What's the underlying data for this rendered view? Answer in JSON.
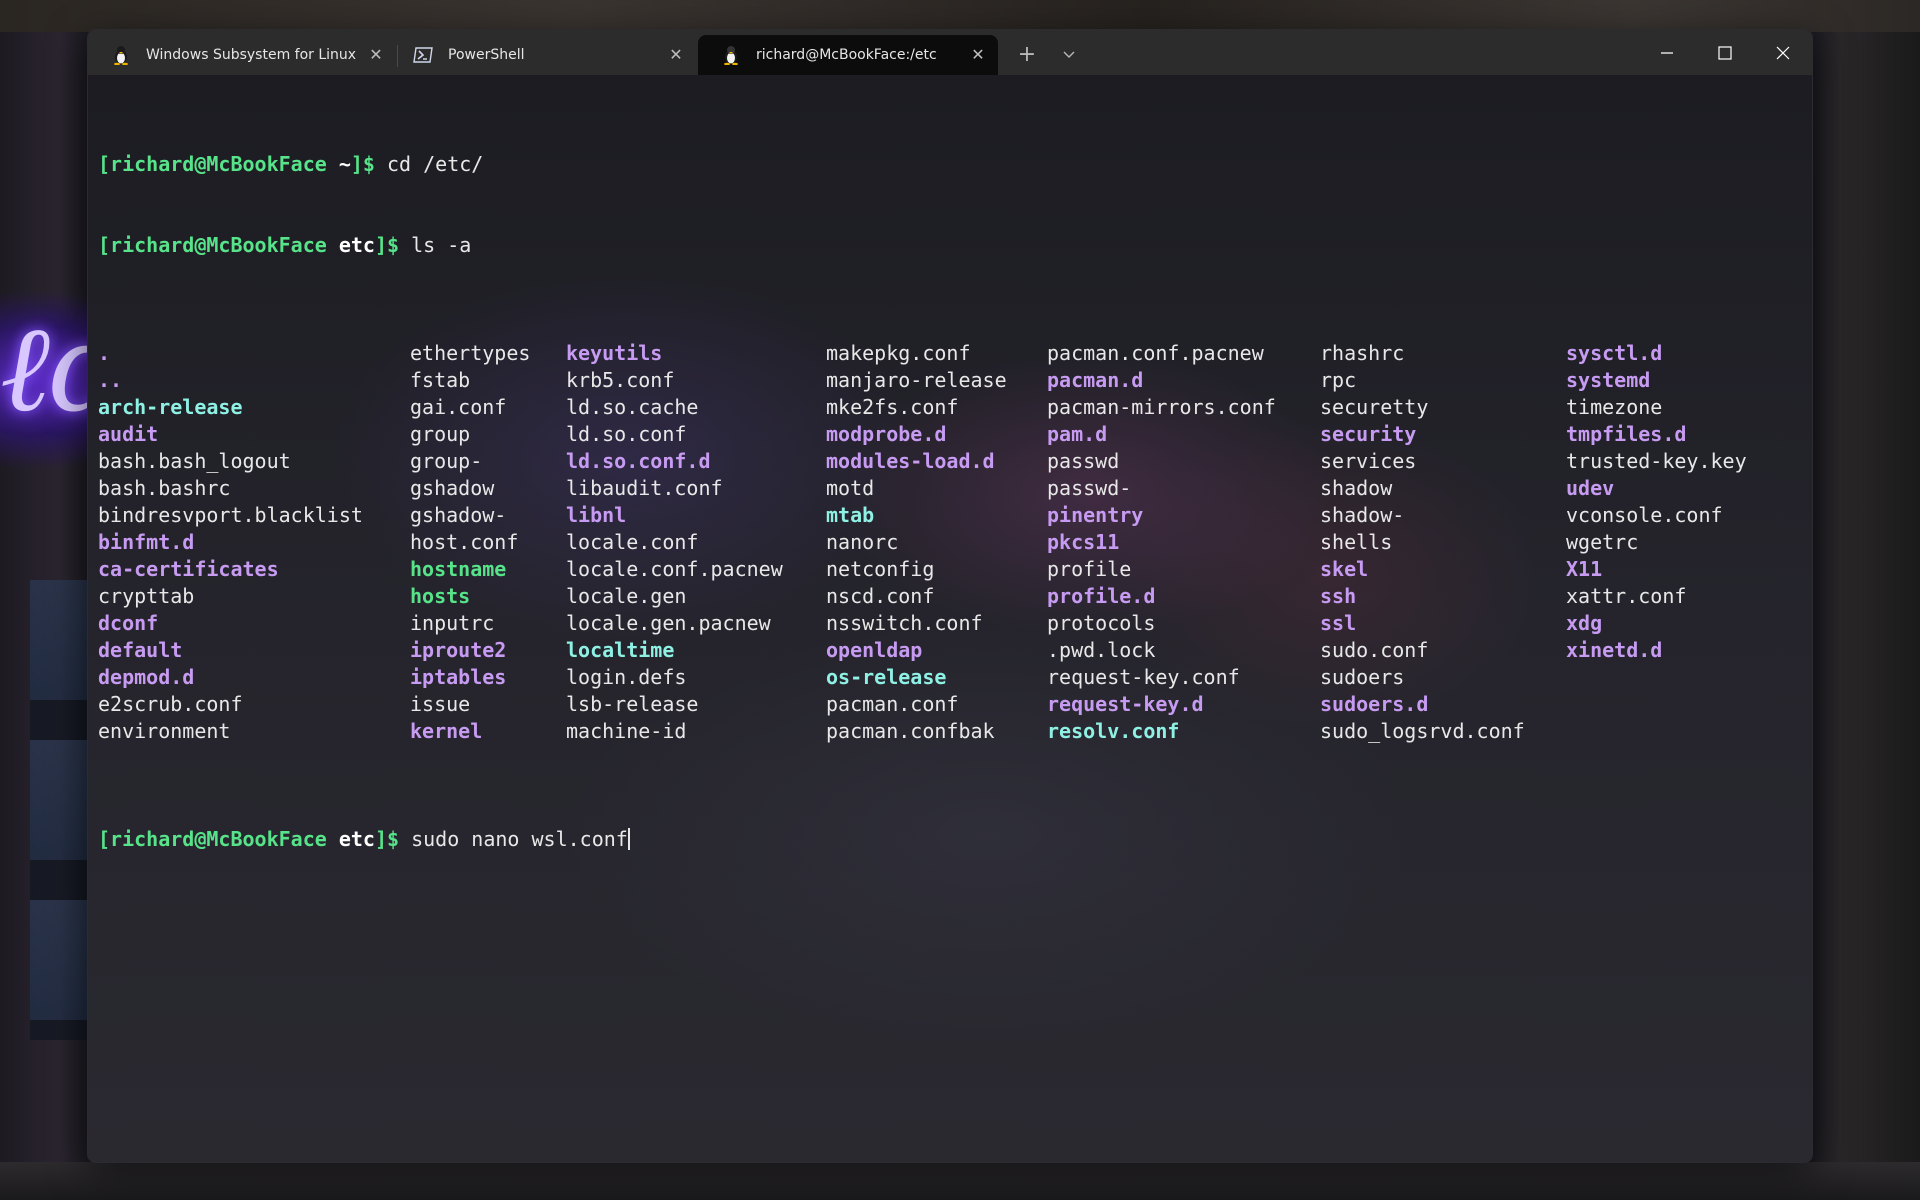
{
  "window": {
    "tabs": [
      {
        "label": "Windows Subsystem for Linux P",
        "icon": "linux-tux-icon",
        "active": false
      },
      {
        "label": "PowerShell",
        "icon": "powershell-icon",
        "active": false
      },
      {
        "label": "richard@McBookFace:/etc",
        "icon": "linux-tux-icon",
        "active": true
      }
    ],
    "new_tab_glyph": "+",
    "dropdown_glyph": "⌄",
    "close_glyph": "✕",
    "controls": {
      "minimize": "—",
      "maximize": "☐",
      "close": "✕"
    }
  },
  "colors": {
    "prompt": "#57e389",
    "directory": "#c79bf2",
    "symlink": "#8ff0e4",
    "executable": "#57e389",
    "file": "#e8e8e8",
    "terminal_bg": "#1e1e24",
    "titlebar_bg": "#2c2c2c"
  },
  "terminal": {
    "lines": [
      {
        "user": "[richard@McBookFace ",
        "dir": "~",
        "suffix": "]$ ",
        "command": "cd /etc/"
      },
      {
        "user": "[richard@McBookFace ",
        "dir": "etc",
        "suffix": "]$ ",
        "command": "ls -a"
      }
    ],
    "ls_columns": [
      [
        {
          "name": ".",
          "type": "dir"
        },
        {
          "name": "..",
          "type": "dir"
        },
        {
          "name": "arch-release",
          "type": "link"
        },
        {
          "name": "audit",
          "type": "dir"
        },
        {
          "name": "bash.bash_logout",
          "type": "file"
        },
        {
          "name": "bash.bashrc",
          "type": "file"
        },
        {
          "name": "bindresvport.blacklist",
          "type": "file"
        },
        {
          "name": "binfmt.d",
          "type": "dir"
        },
        {
          "name": "ca-certificates",
          "type": "dir"
        },
        {
          "name": "crypttab",
          "type": "file"
        },
        {
          "name": "dconf",
          "type": "dir"
        },
        {
          "name": "default",
          "type": "dir"
        },
        {
          "name": "depmod.d",
          "type": "dir"
        },
        {
          "name": "e2scrub.conf",
          "type": "file"
        },
        {
          "name": "environment",
          "type": "file"
        }
      ],
      [
        {
          "name": "ethertypes",
          "type": "file"
        },
        {
          "name": "fstab",
          "type": "file"
        },
        {
          "name": "gai.conf",
          "type": "file"
        },
        {
          "name": "group",
          "type": "file"
        },
        {
          "name": "group-",
          "type": "file"
        },
        {
          "name": "gshadow",
          "type": "file"
        },
        {
          "name": "gshadow-",
          "type": "file"
        },
        {
          "name": "host.conf",
          "type": "file"
        },
        {
          "name": "hostname",
          "type": "exec"
        },
        {
          "name": "hosts",
          "type": "exec"
        },
        {
          "name": "inputrc",
          "type": "file"
        },
        {
          "name": "iproute2",
          "type": "dir"
        },
        {
          "name": "iptables",
          "type": "dir"
        },
        {
          "name": "issue",
          "type": "file"
        },
        {
          "name": "kernel",
          "type": "dir"
        }
      ],
      [
        {
          "name": "keyutils",
          "type": "dir"
        },
        {
          "name": "krb5.conf",
          "type": "file"
        },
        {
          "name": "ld.so.cache",
          "type": "file"
        },
        {
          "name": "ld.so.conf",
          "type": "file"
        },
        {
          "name": "ld.so.conf.d",
          "type": "dir"
        },
        {
          "name": "libaudit.conf",
          "type": "file"
        },
        {
          "name": "libnl",
          "type": "dir"
        },
        {
          "name": "locale.conf",
          "type": "file"
        },
        {
          "name": "locale.conf.pacnew",
          "type": "file"
        },
        {
          "name": "locale.gen",
          "type": "file"
        },
        {
          "name": "locale.gen.pacnew",
          "type": "file"
        },
        {
          "name": "localtime",
          "type": "link"
        },
        {
          "name": "login.defs",
          "type": "file"
        },
        {
          "name": "lsb-release",
          "type": "file"
        },
        {
          "name": "machine-id",
          "type": "file"
        }
      ],
      [
        {
          "name": "makepkg.conf",
          "type": "file"
        },
        {
          "name": "manjaro-release",
          "type": "file"
        },
        {
          "name": "mke2fs.conf",
          "type": "file"
        },
        {
          "name": "modprobe.d",
          "type": "dir"
        },
        {
          "name": "modules-load.d",
          "type": "dir"
        },
        {
          "name": "motd",
          "type": "file"
        },
        {
          "name": "mtab",
          "type": "link"
        },
        {
          "name": "nanorc",
          "type": "file"
        },
        {
          "name": "netconfig",
          "type": "file"
        },
        {
          "name": "nscd.conf",
          "type": "file"
        },
        {
          "name": "nsswitch.conf",
          "type": "file"
        },
        {
          "name": "openldap",
          "type": "dir"
        },
        {
          "name": "os-release",
          "type": "link"
        },
        {
          "name": "pacman.conf",
          "type": "file"
        },
        {
          "name": "pacman.confbak",
          "type": "file"
        }
      ],
      [
        {
          "name": "pacman.conf.pacnew",
          "type": "file"
        },
        {
          "name": "pacman.d",
          "type": "dir"
        },
        {
          "name": "pacman-mirrors.conf",
          "type": "file"
        },
        {
          "name": "pam.d",
          "type": "dir"
        },
        {
          "name": "passwd",
          "type": "file"
        },
        {
          "name": "passwd-",
          "type": "file"
        },
        {
          "name": "pinentry",
          "type": "dir"
        },
        {
          "name": "pkcs11",
          "type": "dir"
        },
        {
          "name": "profile",
          "type": "file"
        },
        {
          "name": "profile.d",
          "type": "dir"
        },
        {
          "name": "protocols",
          "type": "file"
        },
        {
          "name": ".pwd.lock",
          "type": "file"
        },
        {
          "name": "request-key.conf",
          "type": "file"
        },
        {
          "name": "request-key.d",
          "type": "dir"
        },
        {
          "name": "resolv.conf",
          "type": "link"
        }
      ],
      [
        {
          "name": "rhashrc",
          "type": "file"
        },
        {
          "name": "rpc",
          "type": "file"
        },
        {
          "name": "securetty",
          "type": "file"
        },
        {
          "name": "security",
          "type": "dir"
        },
        {
          "name": "services",
          "type": "file"
        },
        {
          "name": "shadow",
          "type": "file"
        },
        {
          "name": "shadow-",
          "type": "file"
        },
        {
          "name": "shells",
          "type": "file"
        },
        {
          "name": "skel",
          "type": "dir"
        },
        {
          "name": "ssh",
          "type": "dir"
        },
        {
          "name": "ssl",
          "type": "dir"
        },
        {
          "name": "sudo.conf",
          "type": "file"
        },
        {
          "name": "sudoers",
          "type": "file"
        },
        {
          "name": "sudoers.d",
          "type": "dir"
        },
        {
          "name": "sudo_logsrvd.conf",
          "type": "file"
        }
      ],
      [
        {
          "name": "sysctl.d",
          "type": "dir"
        },
        {
          "name": "systemd",
          "type": "dir"
        },
        {
          "name": "timezone",
          "type": "file"
        },
        {
          "name": "tmpfiles.d",
          "type": "dir"
        },
        {
          "name": "trusted-key.key",
          "type": "file"
        },
        {
          "name": "udev",
          "type": "dir"
        },
        {
          "name": "vconsole.conf",
          "type": "file"
        },
        {
          "name": "wgetrc",
          "type": "file"
        },
        {
          "name": "X11",
          "type": "dir"
        },
        {
          "name": "xattr.conf",
          "type": "file"
        },
        {
          "name": "xdg",
          "type": "dir"
        },
        {
          "name": "xinetd.d",
          "type": "dir"
        }
      ]
    ],
    "current_prompt": {
      "user": "[richard@McBookFace ",
      "dir": "etc",
      "suffix": "]$ ",
      "input": "sudo nano wsl.conf"
    }
  }
}
